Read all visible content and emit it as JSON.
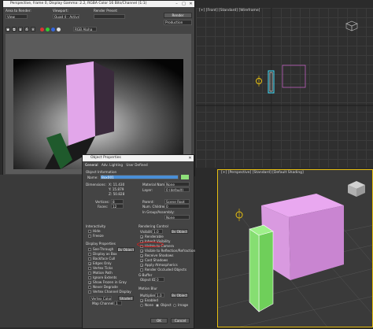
{
  "render_window": {
    "title": "Perspective, frame 0, Display Gamma: 2.2, RGBA Color 16 Bits/Channel (1:1)",
    "area_label": "Area to Render:",
    "area_value": "View",
    "viewport_label": "Viewport:",
    "viewport_value": "Quad 4 - Active",
    "preset_label": "Render Preset:",
    "preset_value": "",
    "render_button": "Render",
    "production_value": "Production",
    "channel_value": "RGB Alpha"
  },
  "viewport_front": {
    "label": "[+] [Front] [Standard] [Wireframe]"
  },
  "viewport_persp": {
    "label": "[+] [Perspective] [Standard] [Default Shading]"
  },
  "object_properties": {
    "title": "Object Properties",
    "tabs": [
      "General",
      "Adv. Lighting",
      "User Defined"
    ],
    "object_info_heading": "Object Information",
    "name_label": "Name:",
    "name_value": "Box001",
    "dimensions_label": "Dimensions:",
    "dim_x": "X: 11.430",
    "dim_y": "Y: 15.879",
    "dim_z": "Z: 50.828",
    "material_name_label": "Material Name:",
    "material_name_value": "None",
    "layer_label": "Layer:",
    "layer_value": "0 (default)",
    "vertices_label": "Vertices:",
    "vertices_value": "8",
    "faces_label": "Faces:",
    "faces_value": "12",
    "parent_label": "Parent:",
    "parent_value": "Scene Root",
    "num_children_label": "Num. Children:",
    "num_children_value": "0",
    "in_group_label": "In Group/Assembly:",
    "in_group_value": "None",
    "interactivity_heading": "Interactivity",
    "hide_label": "Hide",
    "freeze_label": "Freeze",
    "display_props_heading": "Display Properties",
    "display_items": [
      "See-Through",
      "Display as Box",
      "Backface Cull",
      "Edges Only",
      "Vertex Ticks",
      "Motion Path",
      "Ignore Extents",
      "Show Frozen in Gray",
      "Never Degrade",
      "Vertex Channel Display"
    ],
    "display_checked": [
      false,
      false,
      false,
      true,
      false,
      false,
      false,
      true,
      false,
      false
    ],
    "by_object_label": "By Object",
    "vertex_color_value": "Vertex Color",
    "shaded_label": "Shaded",
    "map_channel_label": "Map Channel:",
    "map_channel_value": "1",
    "rendering_control_heading": "Rendering Control",
    "visibility_label": "Visibility:",
    "visibility_value": "1.0",
    "render_items": [
      "Renderable",
      "Inherit Visibility",
      "Visible to Camera",
      "Visible to Reflection/Refraction",
      "Receive Shadows",
      "Cast Shadows",
      "Apply Atmospherics",
      "Render Occluded Objects"
    ],
    "render_checked": [
      true,
      true,
      false,
      true,
      true,
      true,
      true,
      false
    ],
    "gbuffer_heading": "G-Buffer",
    "object_id_label": "Object ID:",
    "object_id_value": "0",
    "motion_blur_heading": "Motion Blur",
    "multiplier_label": "Multiplier:",
    "multiplier_value": "1.0",
    "enabled_label": "Enabled",
    "blur_none": "None",
    "blur_object": "Object",
    "blur_image": "Image",
    "ok_button": "OK",
    "cancel_button": "Cancel",
    "accent_color": "#4a8fd6",
    "highlight_color": "#d02020",
    "swatch_color": "#8ee07a"
  }
}
